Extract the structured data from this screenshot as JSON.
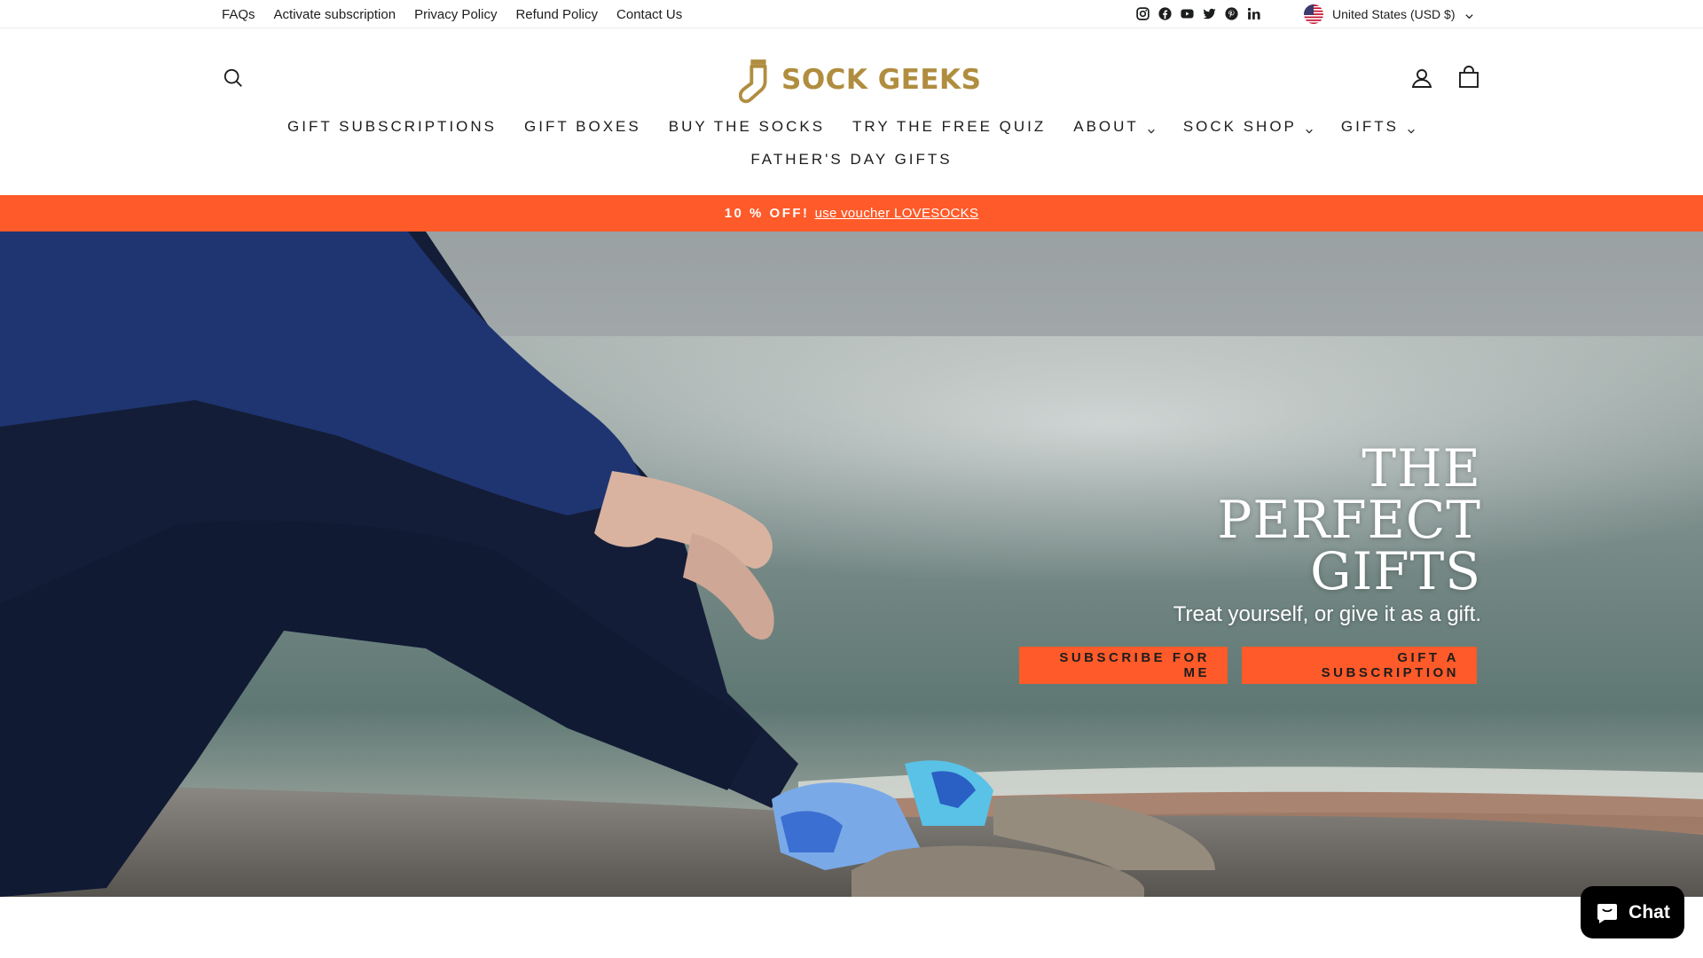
{
  "utility_bar": {
    "links": [
      "FAQs",
      "Activate subscription",
      "Privacy Policy",
      "Refund Policy",
      "Contact Us"
    ],
    "socials": [
      "instagram-icon",
      "facebook-icon",
      "youtube-icon",
      "twitter-icon",
      "pinterest-icon",
      "linkedin-icon"
    ],
    "region": "United States (USD $)"
  },
  "header": {
    "logo_text": "SOCK GEEKS"
  },
  "nav": {
    "row1": [
      {
        "label": "GIFT SUBSCRIPTIONS",
        "has_dropdown": false
      },
      {
        "label": "GIFT BOXES",
        "has_dropdown": false
      },
      {
        "label": "BUY THE SOCKS",
        "has_dropdown": false
      },
      {
        "label": "TRY THE FREE QUIZ",
        "has_dropdown": false
      },
      {
        "label": "ABOUT",
        "has_dropdown": true
      },
      {
        "label": "SOCK SHOP",
        "has_dropdown": true
      },
      {
        "label": "GIFTS",
        "has_dropdown": true
      }
    ],
    "row2": [
      {
        "label": "FATHER'S DAY GIFTS",
        "has_dropdown": false
      }
    ]
  },
  "announcement": {
    "strong": "10 % OFF!",
    "link": "use voucher LOVESOCKS"
  },
  "hero": {
    "title_lines": [
      "THE",
      "PERFECT",
      "GIFTS"
    ],
    "subtitle": "Treat yourself, or give it as a gift.",
    "buttons": {
      "primary": "SUBSCRIBE FOR ME",
      "secondary": "GIFT A SUBSCRIPTION"
    }
  },
  "chat": {
    "label": "Chat"
  },
  "colors": {
    "accent": "#ff5a29",
    "logo_gold": "#b08d3f",
    "text": "#1c1d1d"
  }
}
